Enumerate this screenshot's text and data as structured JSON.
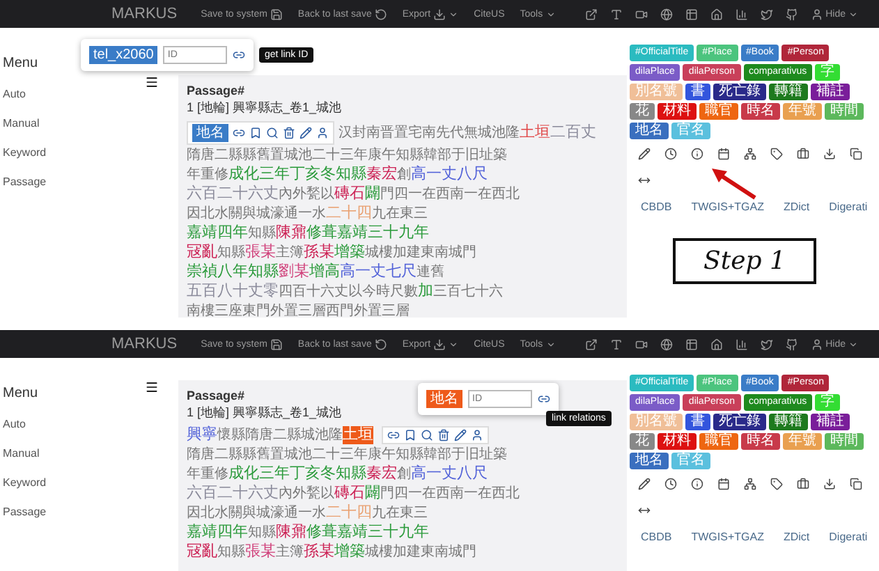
{
  "frames": [
    {
      "navbar": {
        "brand": "MARKUS",
        "items": [
          {
            "label": "Save to system",
            "dropdown": false
          },
          {
            "label": "Back to last save",
            "dropdown": false
          },
          {
            "label": "Export",
            "dropdown": true
          },
          {
            "label": "CiteUS",
            "dropdown": false
          },
          {
            "label": "Tools",
            "dropdown": true
          }
        ],
        "user": {
          "label": "Hide",
          "dropdown": true
        }
      },
      "menu": {
        "title": "Menu",
        "items": [
          "Auto",
          "Manual",
          "Keyword",
          "Passage"
        ]
      },
      "popup": {
        "label": "tel_x2060",
        "placeholder": "ID",
        "tooltip": "get link ID",
        "color": "#3a7cc7"
      },
      "passage": {
        "title": "Passage#",
        "subtitle": "1 [地輪] 興寧縣志_卷1_城池",
        "toolbar_label": "地名",
        "lines": [
          [
            {
              "text": "汉封南晋置宅南先代無城池隆"
            },
            {
              "text": "土垣",
              "color": "#e04848"
            },
            {
              "text": "二百丈",
              "color": "#8a8a9a"
            }
          ],
          [
            {
              "text": "隋唐二縣縣舊置城池二十三年康午知縣韓部于旧址築"
            }
          ],
          [
            {
              "text": "年重修"
            },
            {
              "text": "成化三年丁亥冬知縣",
              "color": "#2a9a3a"
            },
            {
              "text": "秦宏",
              "color": "#cc2255"
            },
            {
              "text": "創"
            },
            {
              "text": "高一丈八尺",
              "color": "#5060d8"
            }
          ],
          [
            {
              "text": "六百二十六丈",
              "color": "#8a8a9a"
            },
            {
              "text": "內外甃以"
            },
            {
              "text": "磚石",
              "color": "#cc2255"
            },
            {
              "text": "闢",
              "color": "#2a9a3a"
            },
            {
              "text": "門四一在西南一在西北"
            }
          ],
          [
            {
              "text": "因北水關與城濠通一水"
            },
            {
              "text": "二十四",
              "color": "#e9a070"
            },
            {
              "text": "九在東三"
            }
          ],
          [
            {
              "text": "嘉靖四年",
              "color": "#2a9a3a"
            },
            {
              "text": "知縣"
            },
            {
              "text": "陳鼐",
              "color": "#cc2255"
            },
            {
              "text": "修葺",
              "color": "#2a9a3a"
            },
            {
              "text": "嘉靖三十九年",
              "color": "#2a9a3a"
            }
          ],
          [
            {
              "text": "冦亂",
              "color": "#cc2255"
            },
            {
              "text": "知縣"
            },
            {
              "text": "張某",
              "color": "#d0407a"
            },
            {
              "text": "主簿"
            },
            {
              "text": "孫某",
              "color": "#cc2255"
            },
            {
              "text": "增築",
              "color": "#2a9a3a"
            },
            {
              "text": "城樓加建東南城門"
            }
          ],
          [
            {
              "text": "崇禎八年知縣",
              "color": "#2a9a3a"
            },
            {
              "text": "劉某",
              "color": "#d0407a"
            },
            {
              "text": "增高",
              "color": "#2a9a3a"
            },
            {
              "text": "高一丈七尺",
              "color": "#5060d8"
            },
            {
              "text": "連舊"
            }
          ],
          [
            {
              "text": "五百八十丈零",
              "color": "#8a8a9a"
            },
            {
              "text": "四百十六丈以今時尺數"
            },
            {
              "text": "加",
              "color": "#2a9a3a"
            },
            {
              "text": "三百七十六"
            }
          ],
          [
            {
              "text": "南樓三座東門外置三層西門外置三層"
            }
          ]
        ]
      },
      "tags": [
        {
          "label": "#OfficialTitle",
          "color": "#2bbbc0"
        },
        {
          "label": "#Place",
          "color": "#4cc47e"
        },
        {
          "label": "#Book",
          "color": "#3a7cc7"
        },
        {
          "label": "#Person",
          "color": "#b0263a"
        },
        {
          "label": "dilaPlace",
          "color": "#7b5cc7"
        },
        {
          "label": "dilaPerson",
          "color": "#c9405a"
        },
        {
          "label": "comparativus",
          "color": "#1e8a1e"
        },
        {
          "label": "字",
          "color": "#33dd33"
        },
        {
          "label": "別名號",
          "color": "#f0bf98"
        },
        {
          "label": "書",
          "color": "#3355dd"
        },
        {
          "label": "死亡錄",
          "color": "#2a2a8a"
        },
        {
          "label": "轉籍",
          "color": "#1e7a1e"
        },
        {
          "label": "補註",
          "color": "#7a1e9a"
        },
        {
          "label": "花",
          "color": "#888888"
        },
        {
          "label": "材料",
          "color": "#dd1111"
        },
        {
          "label": "職官",
          "color": "#ee6611"
        },
        {
          "label": "時名",
          "color": "#c83a4a"
        },
        {
          "label": "年號",
          "color": "#e9a050"
        },
        {
          "label": "時間",
          "color": "#5cb85c"
        },
        {
          "label": "地名",
          "color": "#3a6fbf"
        },
        {
          "label": "官名",
          "color": "#5bc0de"
        }
      ],
      "links": [
        "CBDB",
        "TWGIS+TGAZ",
        "ZDict",
        "Digerati"
      ],
      "annotation": "Step 1"
    },
    {
      "navbar": {
        "brand": "MARKUS",
        "items": [
          {
            "label": "Save to system",
            "dropdown": false
          },
          {
            "label": "Back to last save",
            "dropdown": false
          },
          {
            "label": "Export",
            "dropdown": true
          },
          {
            "label": "CiteUS",
            "dropdown": false
          },
          {
            "label": "Tools",
            "dropdown": true
          }
        ],
        "user": {
          "label": "Hide",
          "dropdown": true
        }
      },
      "menu": {
        "title": "Menu",
        "items": [
          "Auto",
          "Manual",
          "Keyword",
          "Passage"
        ]
      },
      "popup": {
        "label": "地名",
        "placeholder": "ID",
        "tooltip": "link relations",
        "color": "#ee5a1a"
      },
      "passage": {
        "title": "Passage#",
        "subtitle": "1 [地輪] 興寧縣志_卷1_城池",
        "lines": [
          [
            {
              "text": "興寧",
              "color": "#5060d8"
            },
            {
              "text": "懷縣隋唐二縣城池隆"
            },
            {
              "text": "土垣",
              "color": "#ee5a1a",
              "selected": true
            }
          ],
          [
            {
              "text": "隋唐二縣縣舊置城池二十三年康午知縣韓部于旧址築"
            }
          ],
          [
            {
              "text": "年重修"
            },
            {
              "text": "成化三年丁亥冬知縣",
              "color": "#2a9a3a"
            },
            {
              "text": "秦宏",
              "color": "#cc2255"
            },
            {
              "text": "創"
            },
            {
              "text": "高一丈八尺",
              "color": "#5060d8"
            }
          ],
          [
            {
              "text": "六百二十六丈",
              "color": "#8a8a9a"
            },
            {
              "text": "內外甃以"
            },
            {
              "text": "磚石",
              "color": "#cc2255"
            },
            {
              "text": "闢",
              "color": "#2a9a3a"
            },
            {
              "text": "門四一在西南一在西北"
            }
          ],
          [
            {
              "text": "因北水關與城濠通一水"
            },
            {
              "text": "二十四",
              "color": "#e9a070"
            },
            {
              "text": "九在東三"
            }
          ],
          [
            {
              "text": "嘉靖四年",
              "color": "#2a9a3a"
            },
            {
              "text": "知縣"
            },
            {
              "text": "陳鼐",
              "color": "#cc2255"
            },
            {
              "text": "修葺",
              "color": "#2a9a3a"
            },
            {
              "text": "嘉靖三十九年",
              "color": "#2a9a3a"
            }
          ],
          [
            {
              "text": "冦亂",
              "color": "#cc2255"
            },
            {
              "text": "知縣"
            },
            {
              "text": "張某",
              "color": "#d0407a"
            },
            {
              "text": "主簿"
            },
            {
              "text": "孫某",
              "color": "#cc2255"
            },
            {
              "text": "增築",
              "color": "#2a9a3a"
            },
            {
              "text": "城樓加建東南城門"
            }
          ]
        ]
      },
      "tags": [
        {
          "label": "#OfficialTitle",
          "color": "#2bbbc0"
        },
        {
          "label": "#Place",
          "color": "#4cc47e"
        },
        {
          "label": "#Book",
          "color": "#3a7cc7"
        },
        {
          "label": "#Person",
          "color": "#b0263a"
        },
        {
          "label": "dilaPlace",
          "color": "#7b5cc7"
        },
        {
          "label": "dilaPerson",
          "color": "#c9405a"
        },
        {
          "label": "comparativus",
          "color": "#1e8a1e"
        },
        {
          "label": "字",
          "color": "#33dd33"
        },
        {
          "label": "別名號",
          "color": "#f0bf98"
        },
        {
          "label": "書",
          "color": "#3355dd"
        },
        {
          "label": "死亡錄",
          "color": "#2a2a8a"
        },
        {
          "label": "轉籍",
          "color": "#1e7a1e"
        },
        {
          "label": "補註",
          "color": "#7a1e9a"
        },
        {
          "label": "花",
          "color": "#888888"
        },
        {
          "label": "材料",
          "color": "#dd1111"
        },
        {
          "label": "職官",
          "color": "#ee6611"
        },
        {
          "label": "時名",
          "color": "#c83a4a"
        },
        {
          "label": "年號",
          "color": "#e9a050"
        },
        {
          "label": "時間",
          "color": "#5cb85c"
        },
        {
          "label": "地名",
          "color": "#3a6fbf"
        },
        {
          "label": "官名",
          "color": "#5bc0de"
        }
      ],
      "links": [
        "CBDB",
        "TWGIS+TGAZ",
        "ZDict",
        "Digerati"
      ]
    }
  ]
}
